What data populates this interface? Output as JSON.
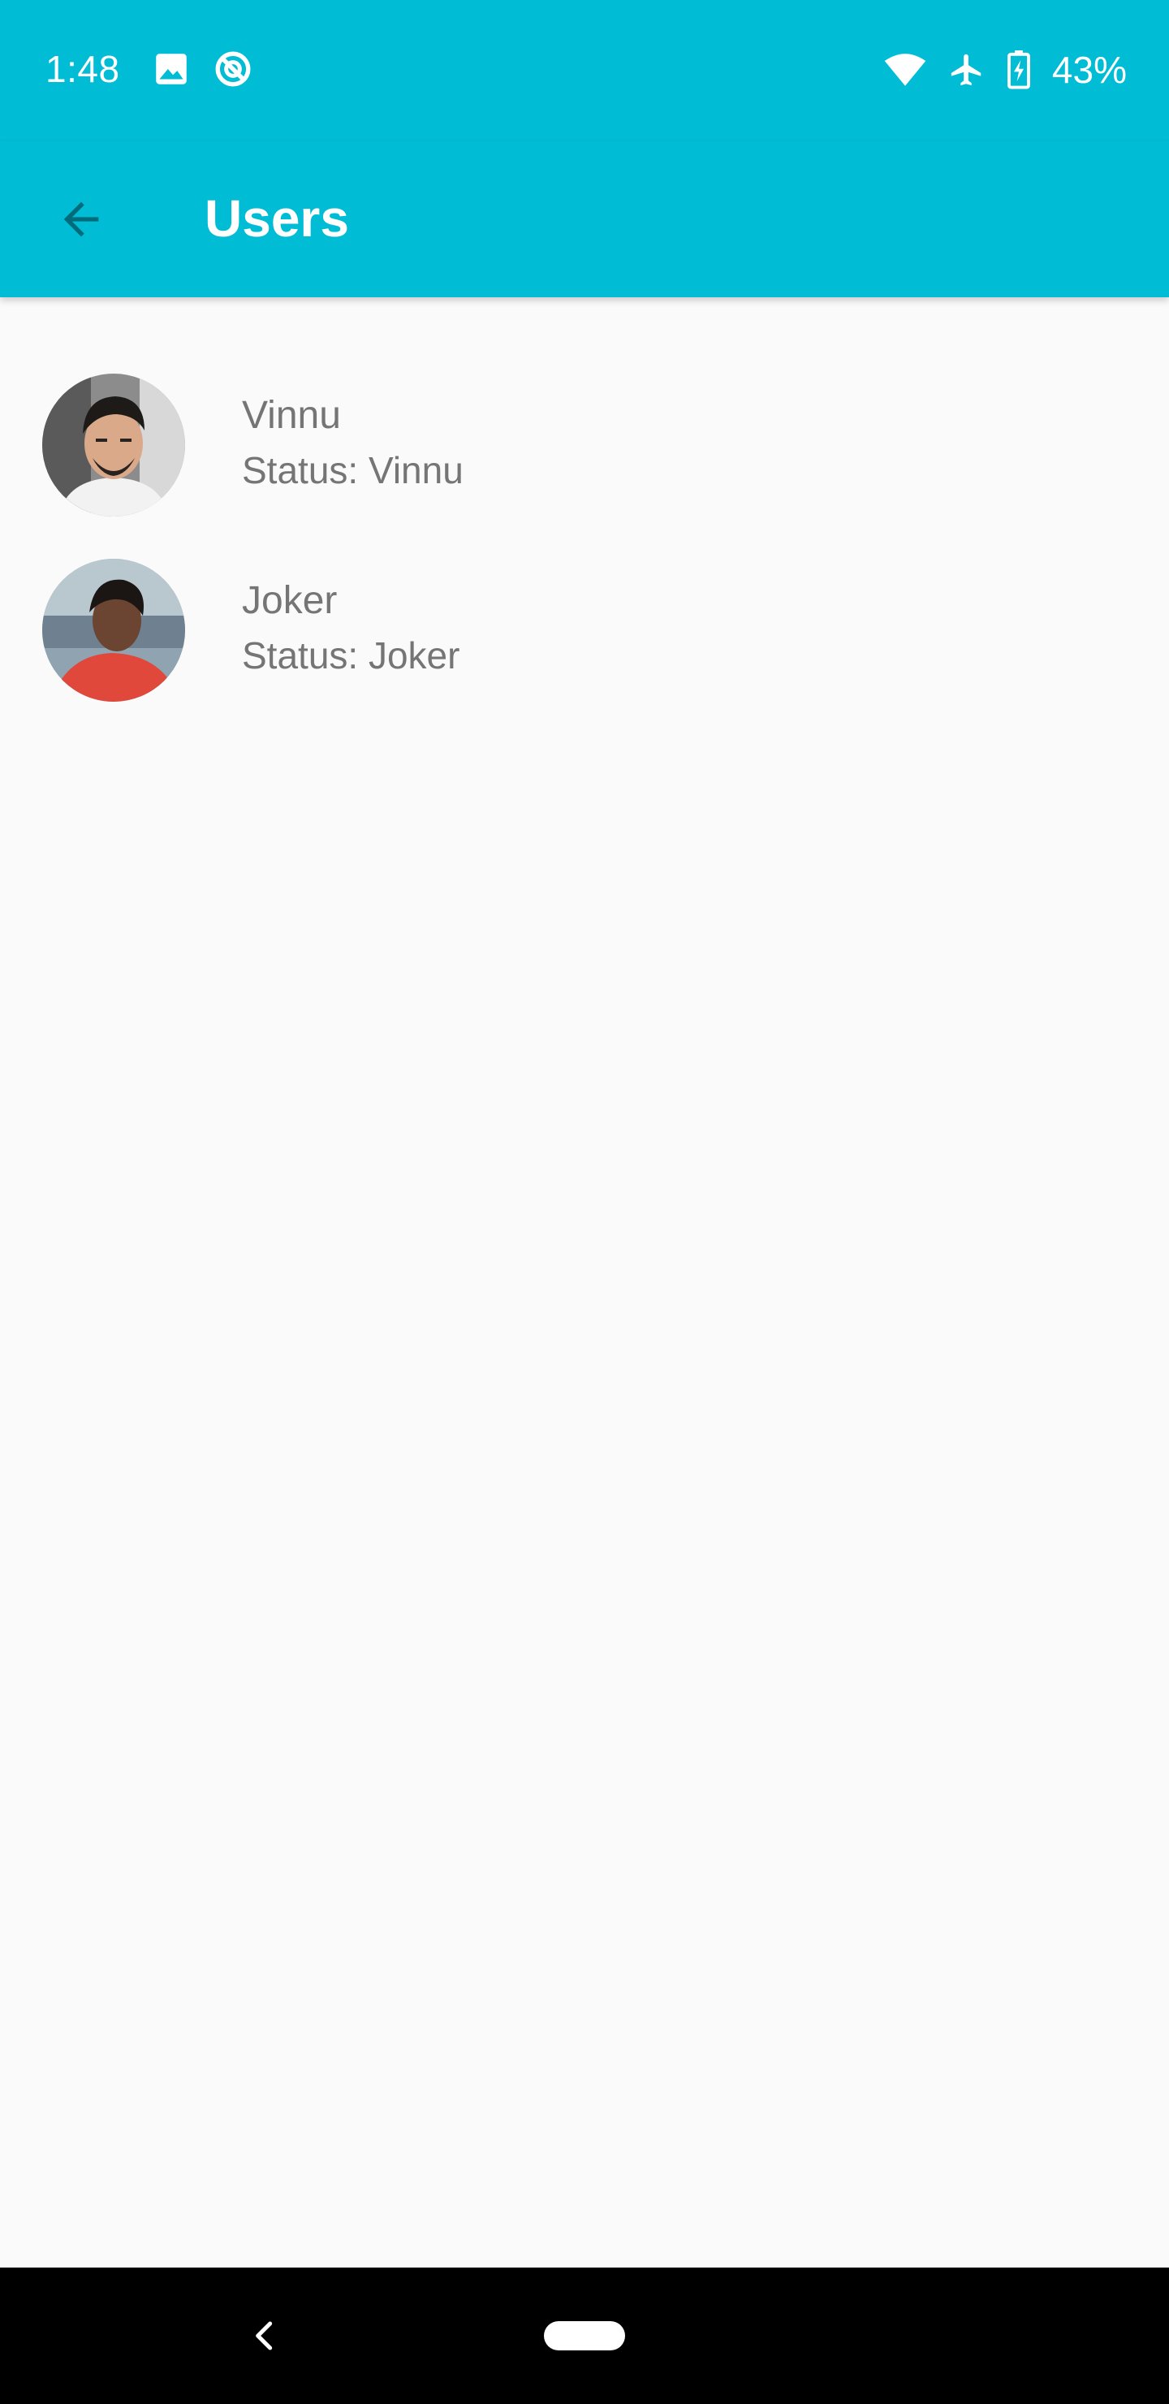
{
  "status_bar": {
    "time": "1:48",
    "battery": "43%",
    "icons": [
      "image-icon",
      "sync-disabled-icon",
      "wifi-icon",
      "airplane-icon",
      "battery-charging-icon"
    ]
  },
  "app_bar": {
    "title": "Users",
    "back_icon": "arrow-back-icon"
  },
  "users": [
    {
      "name": "Vinnu",
      "status": "Status: Vinnu"
    },
    {
      "name": "Joker",
      "status": "Status: Joker"
    }
  ],
  "nav_bar": {
    "icons": [
      "nav-back-icon",
      "home-pill-icon"
    ]
  },
  "colors": {
    "primary": "#00bcd4",
    "background": "#fafafa",
    "text_secondary": "#757575",
    "back_arrow": "#006b7a"
  }
}
